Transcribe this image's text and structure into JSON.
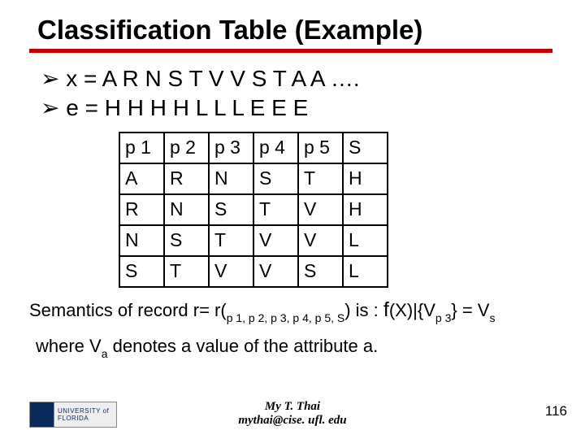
{
  "title": "Classification Table (Example)",
  "bullets": {
    "x": "x =   A R N S T V V S T A A ….",
    "e": "e  =   H H H H L L L  E E E"
  },
  "table": {
    "rows": [
      [
        "p 1",
        "p 2",
        "p 3",
        "p 4",
        "p 5",
        "S"
      ],
      [
        "A",
        "R",
        "N",
        "S",
        "T",
        "H"
      ],
      [
        "R",
        "N",
        "S",
        "T",
        "V",
        "H"
      ],
      [
        "N",
        "S",
        "T",
        "V",
        " V",
        "L"
      ],
      [
        "S",
        "T",
        "V",
        "V",
        "S",
        "L"
      ]
    ]
  },
  "semantics": {
    "prefix": "Semantics of record r= r(",
    "args": "p 1, p 2,  p 3, p 4, p 5, S",
    "mid": ")  is : ",
    "f": "f",
    "fx": "(X)|{V",
    "p3": "p 3",
    "brace": "} = V",
    "s": "s"
  },
  "where": {
    "line": "where V",
    "a": "a",
    "rest": "  denotes a value of the attribute a."
  },
  "footer": {
    "logo": "UNIVERSITY of FLORIDA",
    "name": "My T. Thai",
    "email": "mythai@cise. ufl. edu",
    "page": "116"
  }
}
